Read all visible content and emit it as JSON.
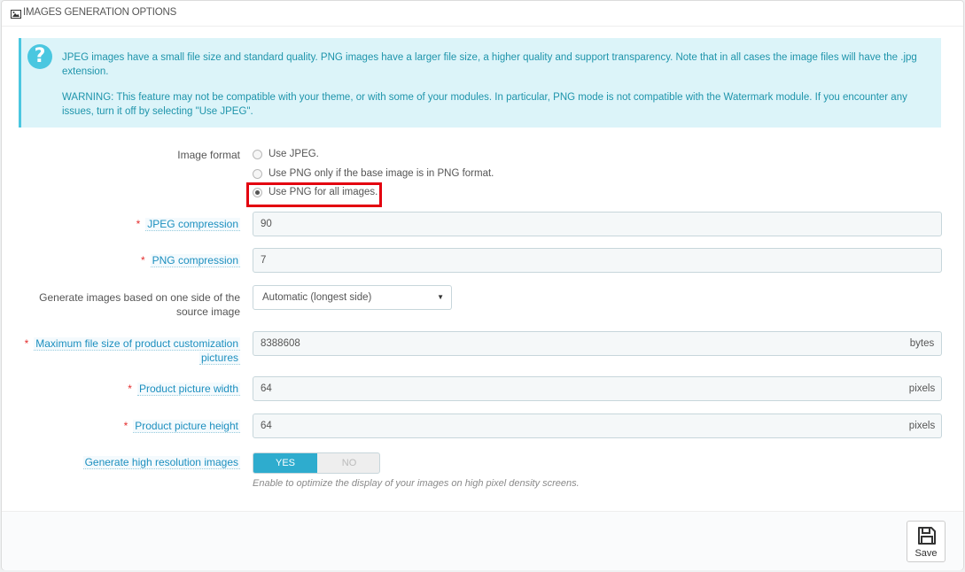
{
  "panel": {
    "title": "IMAGES GENERATION OPTIONS",
    "icon": "image-icon"
  },
  "alert": {
    "icon": "question-icon",
    "text1": "JPEG images have a small file size and standard quality. PNG images have a larger file size, a higher quality and support transparency. Note that in all cases the image files will have the .jpg extension.",
    "text2": "WARNING: This feature may not be compatible with your theme, or with some of your modules. In particular, PNG mode is not compatible with the Watermark module. If you encounter any issues, turn it off by selecting \"Use JPEG\"."
  },
  "image_format": {
    "label": "Image format",
    "options": [
      {
        "label": "Use JPEG.",
        "checked": false
      },
      {
        "label": "Use PNG only if the base image is in PNG format.",
        "checked": false
      },
      {
        "label": "Use PNG for all images.",
        "checked": true
      }
    ]
  },
  "jpeg_compression": {
    "label": "JPEG compression",
    "required": "*",
    "value": "90"
  },
  "png_compression": {
    "label": "PNG compression",
    "required": "*",
    "value": "7"
  },
  "generate_side": {
    "label_line1": "Generate images based on one side of the",
    "label_line2": "source image",
    "value": "Automatic (longest side)"
  },
  "max_file_size": {
    "label_line1": "Maximum file size of product customization",
    "label_line2": "pictures",
    "required": "*",
    "value": "8388608",
    "unit": "bytes"
  },
  "picture_width": {
    "label": "Product picture width",
    "required": "*",
    "value": "64",
    "unit": "pixels"
  },
  "picture_height": {
    "label": "Product picture height",
    "required": "*",
    "value": "64",
    "unit": "pixels"
  },
  "high_res": {
    "label": "Generate high resolution images",
    "yes": "YES",
    "no": "NO",
    "enabled": true,
    "help": "Enable to optimize the display of your images on high pixel density screens."
  },
  "footer": {
    "save_label": "Save"
  },
  "colors": {
    "accent": "#2eacce",
    "alert_bg": "#dcf4f9",
    "alert_text": "#1e94ab",
    "required": "#e42d2d",
    "highlight": "#e3000f"
  }
}
